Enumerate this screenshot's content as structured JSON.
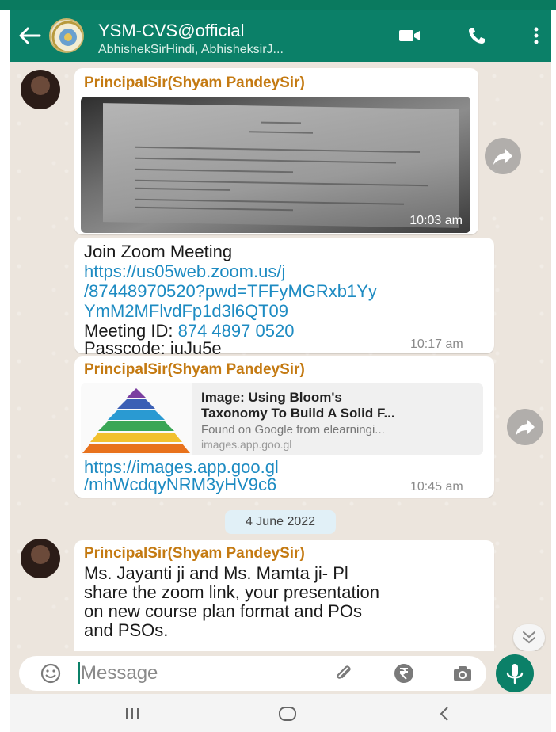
{
  "header": {
    "title": "YSM-CVS@official",
    "subtitle": "AbhishekSirHindi, AbhisheksirJ..."
  },
  "messages": {
    "photo_msg": {
      "sender": "PrincipalSir(Shyam PandeySir)",
      "time": "10:03 am"
    },
    "zoom_msg": {
      "line1": "Join Zoom Meeting",
      "link_line1": "https://us05web.zoom.us/j",
      "link_line2": "/87448970520?pwd=TFFyMGRxb1Yy",
      "link_line3": "YmM2MFlvdFp1d3l6QT09",
      "meeting_id_label": "Meeting ID: ",
      "meeting_id": "874 4897 0520",
      "passcode": "Passcode: iuJu5e",
      "time": "10:17 am"
    },
    "link_msg": {
      "sender": "PrincipalSir(Shyam PandeySir)",
      "preview_title_1": "Image: Using Bloom's",
      "preview_title_2": "Taxonomy To Build A Solid F...",
      "preview_desc": "Found on Google from elearningi...",
      "preview_domain": "images.app.goo.gl",
      "link_line1": "https://images.app.goo.gl",
      "link_line2": "/mhWcdqyNRM3yHV9c6",
      "time": "10:45 am"
    },
    "date_divider": "4 June 2022",
    "text_msg": {
      "sender": "PrincipalSir(Shyam PandeySir)",
      "line1": "Ms. Jayanti ji and Ms. Mamta ji- Pl",
      "line2": "share the zoom link, your presentation",
      "line3": "on new course plan format and POs",
      "line4": "and PSOs."
    }
  },
  "composer": {
    "placeholder": "Message"
  },
  "icons": {
    "back": "back-arrow-icon",
    "video": "video-call-icon",
    "phone": "phone-icon",
    "menu": "more-vert-icon",
    "emoji": "emoji-icon",
    "attach": "paperclip-icon",
    "payment": "rupee-icon",
    "camera": "camera-icon",
    "mic": "mic-icon",
    "forward": "forward-icon",
    "scroll": "chevron-double-down-icon"
  },
  "colors": {
    "header": "#0b8068",
    "sender": "#c47a12",
    "link": "#1d8bc2",
    "chat_bg": "#ece5dd"
  }
}
